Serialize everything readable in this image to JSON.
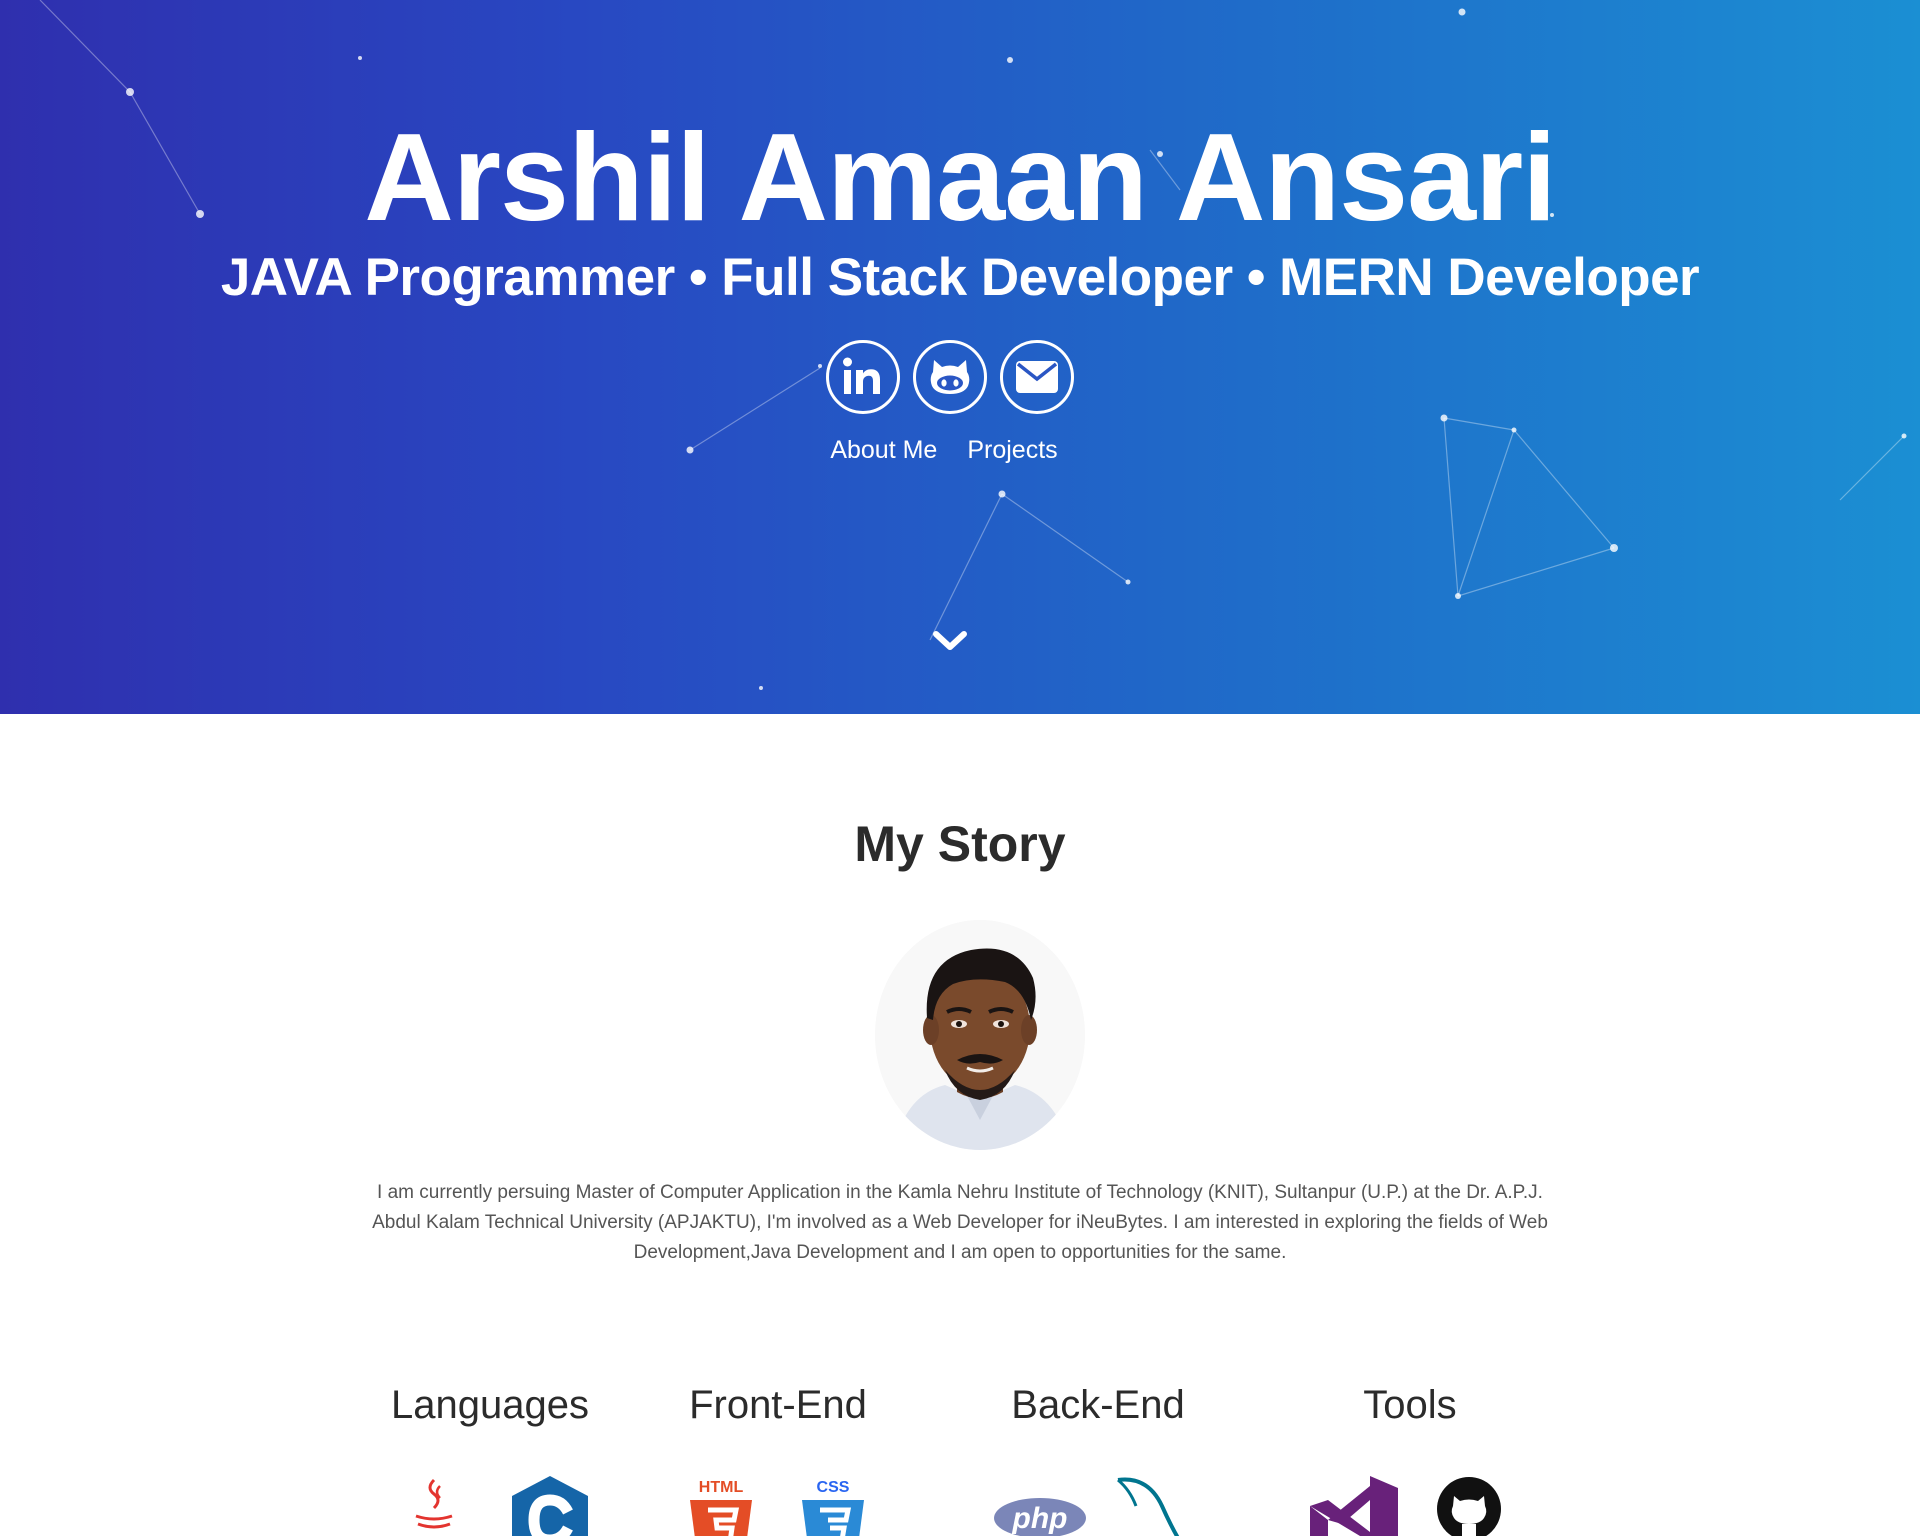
{
  "hero": {
    "name": "Arshil Amaan Ansari",
    "subtitle": "JAVA Programmer • Full Stack Developer • MERN Developer",
    "social": [
      {
        "icon": "linkedin-icon"
      },
      {
        "icon": "github-icon"
      },
      {
        "icon": "envelope-icon"
      }
    ],
    "links": {
      "about": "About Me",
      "projects": "Projects"
    },
    "scroll_icon": "chevron-down-icon",
    "colors": {
      "gradient_start": "#2f2fae",
      "gradient_end": "#1b8fd3"
    }
  },
  "story": {
    "title": "My Story",
    "paragraph": "I am currently persuing Master of Computer Application in the Kamla Nehru Institute of Technology (KNIT), Sultanpur (U.P.) at the Dr. A.P.J. Abdul Kalam Technical University (APJAKTU), I'm involved as a Web Developer for iNeuBytes. I am interested in exploring the fields of Web Development,Java Development and I am open to opportunities for the same."
  },
  "skills": {
    "languages": {
      "title": "Languages",
      "icons": [
        "java-icon",
        "c-language-icon"
      ]
    },
    "frontend": {
      "title": "Front-End",
      "icons": [
        "html5-icon",
        "css3-icon"
      ],
      "badges": {
        "html": "HTML",
        "css": "CSS"
      }
    },
    "backend": {
      "title": "Back-End",
      "icons": [
        "php-icon",
        "mysql-dolphin-icon"
      ],
      "badges": {
        "php": "php"
      }
    },
    "tools": {
      "title": "Tools",
      "icons": [
        "visual-studio-icon",
        "github-icon"
      ]
    }
  }
}
